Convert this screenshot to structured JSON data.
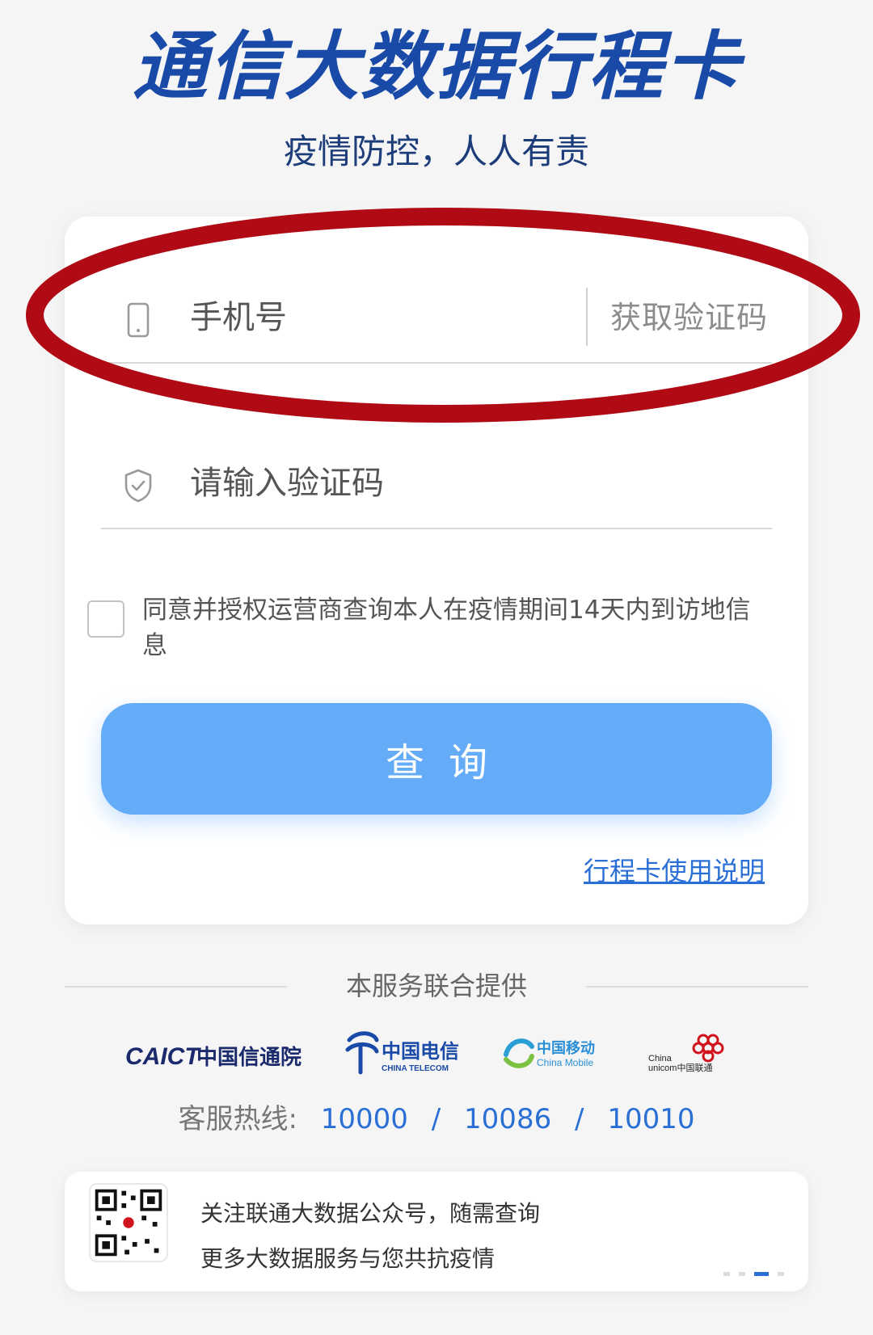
{
  "header": {
    "title": "通信大数据行程卡",
    "subtitle": "疫情防控，人人有责"
  },
  "form": {
    "phone_placeholder": "手机号",
    "get_code_label": "获取验证码",
    "code_placeholder": "请输入验证码",
    "agree_text": "同意并授权运营商查询本人在疫情期间14天内到访地信息",
    "query_button": "查询",
    "guide_link": "行程卡使用说明"
  },
  "providers": {
    "label": "本服务联合提供",
    "logos": {
      "caict_en": "CAICT",
      "caict_cn": "中国信通院",
      "telecom_cn": "中国电信",
      "telecom_en": "CHINA TELECOM",
      "mobile_cn": "中国移动",
      "mobile_en": "China Mobile",
      "unicom_en_top": "China",
      "unicom_en_bottom": "unicom中国联通"
    }
  },
  "hotline": {
    "label": "客服热线:",
    "numbers": [
      "10000",
      "10086",
      "10010"
    ],
    "separator": "/"
  },
  "banner": {
    "line1": "关注联通大数据公众号，随需查询",
    "line2": "更多大数据服务与您共抗疫情"
  },
  "colors": {
    "title": "#1a4aa8",
    "button": "#64acf7",
    "link": "#2a6fd6",
    "annotation_ellipse": "#b00a14"
  },
  "icons": {
    "phone": "phone-icon",
    "shield": "shield-check-icon",
    "qr": "qr-code-icon"
  }
}
